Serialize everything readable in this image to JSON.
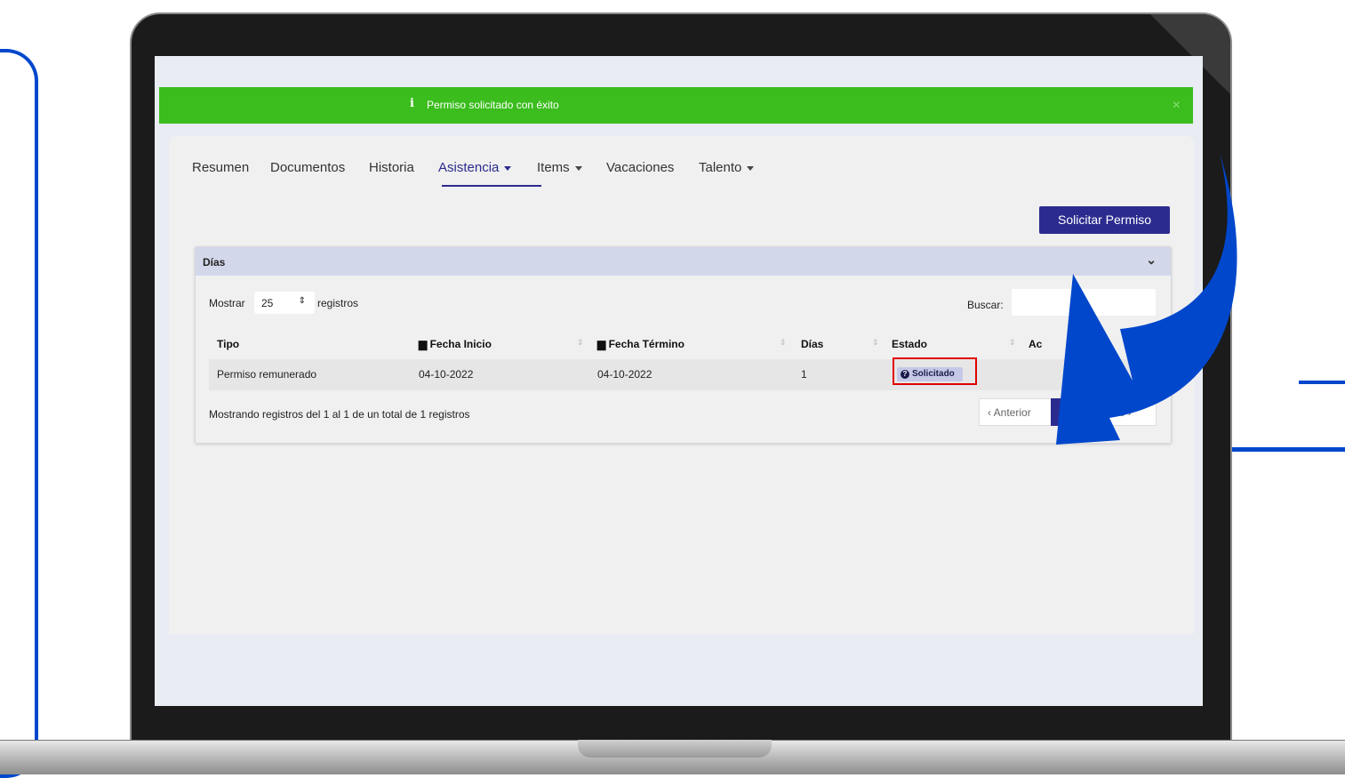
{
  "alert": {
    "icon": "info-icon",
    "icon_glyph": "i",
    "message": "Permiso solicitado con éxito",
    "close_glyph": "×"
  },
  "tabs": [
    {
      "label": "Resumen",
      "dropdown": false,
      "active": false
    },
    {
      "label": "Documentos",
      "dropdown": false,
      "active": false
    },
    {
      "label": "Historia",
      "dropdown": false,
      "active": false
    },
    {
      "label": "Asistencia",
      "dropdown": true,
      "active": true
    },
    {
      "label": "Items",
      "dropdown": true,
      "active": false
    },
    {
      "label": "Vacaciones",
      "dropdown": false,
      "active": false
    },
    {
      "label": "Talento",
      "dropdown": true,
      "active": false
    }
  ],
  "actions": {
    "request_button": "Solicitar Permiso"
  },
  "panel": {
    "title": "Días",
    "collapse_glyph": "⌄",
    "show_prefix": "Mostrar",
    "page_length": "25",
    "show_suffix": "registros",
    "search_label": "Buscar:",
    "search_value": "",
    "columns": [
      {
        "label": "Tipo",
        "icon": null
      },
      {
        "label": "Fecha Inicio",
        "icon": "calendar-icon"
      },
      {
        "label": "Fecha Término",
        "icon": "calendar-icon"
      },
      {
        "label": "Días",
        "icon": null
      },
      {
        "label": "Estado",
        "icon": null
      },
      {
        "label": "Ac",
        "icon": null
      }
    ],
    "rows": [
      {
        "tipo": "Permiso remunerado",
        "fecha_inicio": "04-10-2022",
        "fecha_termino": "04-10-2022",
        "dias": "1",
        "estado": "Solicitado",
        "estado_icon": "question-circle-icon"
      }
    ],
    "info": "Mostrando registros del 1 al 1 de un total de 1 registros",
    "pagination": {
      "prev": "‹ Anterior",
      "current": "1",
      "next": "ante ›"
    }
  },
  "colors": {
    "accent": "#2b2b8f",
    "alert_green": "#3bbd1d",
    "highlight_red": "#e10000",
    "annotation_blue": "#0047cc",
    "panel_header": "#d3d7ea"
  }
}
